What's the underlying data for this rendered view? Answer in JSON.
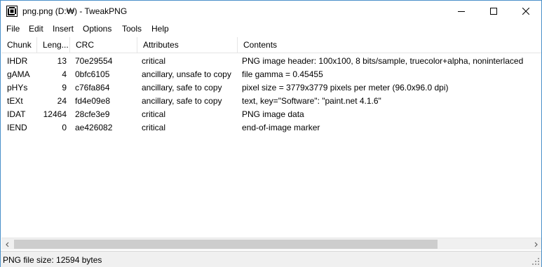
{
  "window": {
    "title": "png.png (D:₩) - TweakPNG",
    "app_icon": "tweakpng-app-icon"
  },
  "window_controls": {
    "minimize": "minimize-icon",
    "maximize": "maximize-icon",
    "close": "close-icon"
  },
  "menu": {
    "items": [
      "File",
      "Edit",
      "Insert",
      "Options",
      "Tools",
      "Help"
    ]
  },
  "table": {
    "columns": [
      "Chunk",
      "Leng...",
      "CRC",
      "Attributes",
      "Contents"
    ],
    "rows": [
      [
        "IHDR",
        "13",
        "70e29554",
        "critical",
        "PNG image header: 100x100, 8 bits/sample, truecolor+alpha, noninterlaced"
      ],
      [
        "gAMA",
        "4",
        "0bfc6105",
        "ancillary, unsafe to copy",
        "file gamma = 0.45455"
      ],
      [
        "pHYs",
        "9",
        "c76fa864",
        "ancillary, safe to copy",
        "pixel size = 3779x3779 pixels per meter (96.0x96.0 dpi)"
      ],
      [
        "tEXt",
        "24",
        "fd4e09e8",
        "ancillary, safe to copy",
        "text, key=\"Software\": \"paint.net 4.1.6\""
      ],
      [
        "IDAT",
        "12464",
        "28cfe3e9",
        "critical",
        "PNG image data"
      ],
      [
        "IEND",
        "0",
        "ae426082",
        "critical",
        "end-of-image marker"
      ]
    ]
  },
  "status": {
    "text": "PNG file size: 12594 bytes"
  },
  "colors": {
    "border": "#4a90c9",
    "statusbar_bg": "#f0f0f0",
    "scroll_thumb": "#cdcdcd"
  }
}
